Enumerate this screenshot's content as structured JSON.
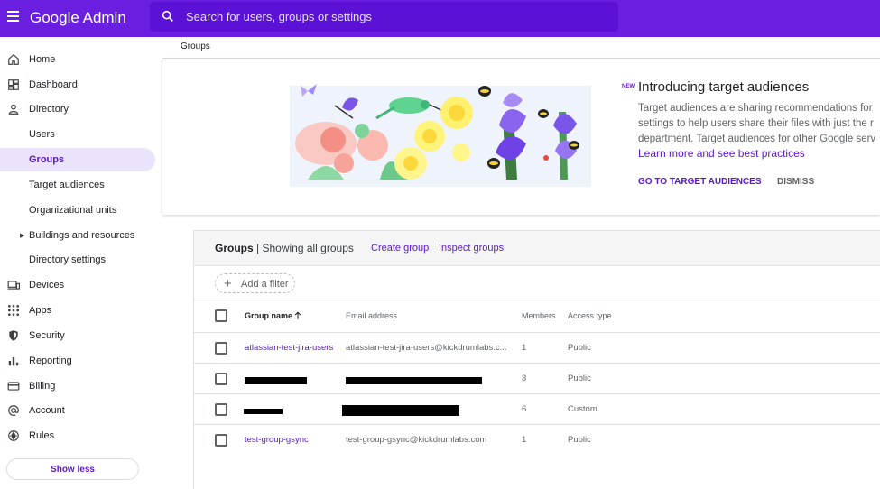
{
  "app": {
    "brand": "Google Admin"
  },
  "search": {
    "placeholder": "Search for users, groups or settings"
  },
  "sidebar": {
    "items": [
      {
        "label": "Home",
        "icon": "home-icon"
      },
      {
        "label": "Dashboard",
        "icon": "dashboard-icon"
      },
      {
        "label": "Directory",
        "icon": "person-icon"
      },
      {
        "label": "Users"
      },
      {
        "label": "Groups",
        "active": true
      },
      {
        "label": "Target audiences"
      },
      {
        "label": "Organizational units"
      },
      {
        "label": "Buildings and resources",
        "expandable": true
      },
      {
        "label": "Directory settings"
      },
      {
        "label": "Devices",
        "icon": "devices-icon"
      },
      {
        "label": "Apps",
        "icon": "apps-grid-icon"
      },
      {
        "label": "Security",
        "icon": "shield-icon"
      },
      {
        "label": "Reporting",
        "icon": "bar-chart-icon"
      },
      {
        "label": "Billing",
        "icon": "credit-card-icon"
      },
      {
        "label": "Account",
        "icon": "at-sign-icon"
      },
      {
        "label": "Rules",
        "icon": "rules-icon"
      }
    ],
    "show_less": "Show less"
  },
  "breadcrumb": "Groups",
  "promo": {
    "badge": "NEW",
    "title": "Introducing target audiences",
    "body_lines": [
      "Target audiences are sharing recommendations for",
      "settings to help users share their files with just the r",
      "department. Target audiences for other Google serv"
    ],
    "link": "Learn more and see best practices",
    "primary_button": "GO TO TARGET AUDIENCES",
    "dismiss_button": "DISMISS"
  },
  "panel": {
    "title": "Groups",
    "subtitle": "| Showing all groups",
    "create_group": "Create group",
    "inspect_groups": "Inspect groups",
    "add_filter": "Add a filter"
  },
  "table": {
    "headers": {
      "name": "Group name",
      "email": "Email address",
      "members": "Members",
      "access": "Access type"
    },
    "rows": [
      {
        "name": "atlassian-test-jira-users",
        "email": "atlassian-test-jira-users@kickdrumlabs.c...",
        "members": "1",
        "access": "Public",
        "redacted": false
      },
      {
        "name": "",
        "email": "",
        "members": "3",
        "access": "Public",
        "redacted": true
      },
      {
        "name": "",
        "email": "",
        "members": "6",
        "access": "Custom",
        "redacted": true
      },
      {
        "name": "test-group-gsync",
        "email": "test-group-gsync@kickdrumlabs.com",
        "members": "1",
        "access": "Public",
        "redacted": false
      }
    ]
  },
  "colors": {
    "topbar": "#6a1ee0",
    "accent": "#5a16d3",
    "active_bg": "#ebe3fb"
  }
}
